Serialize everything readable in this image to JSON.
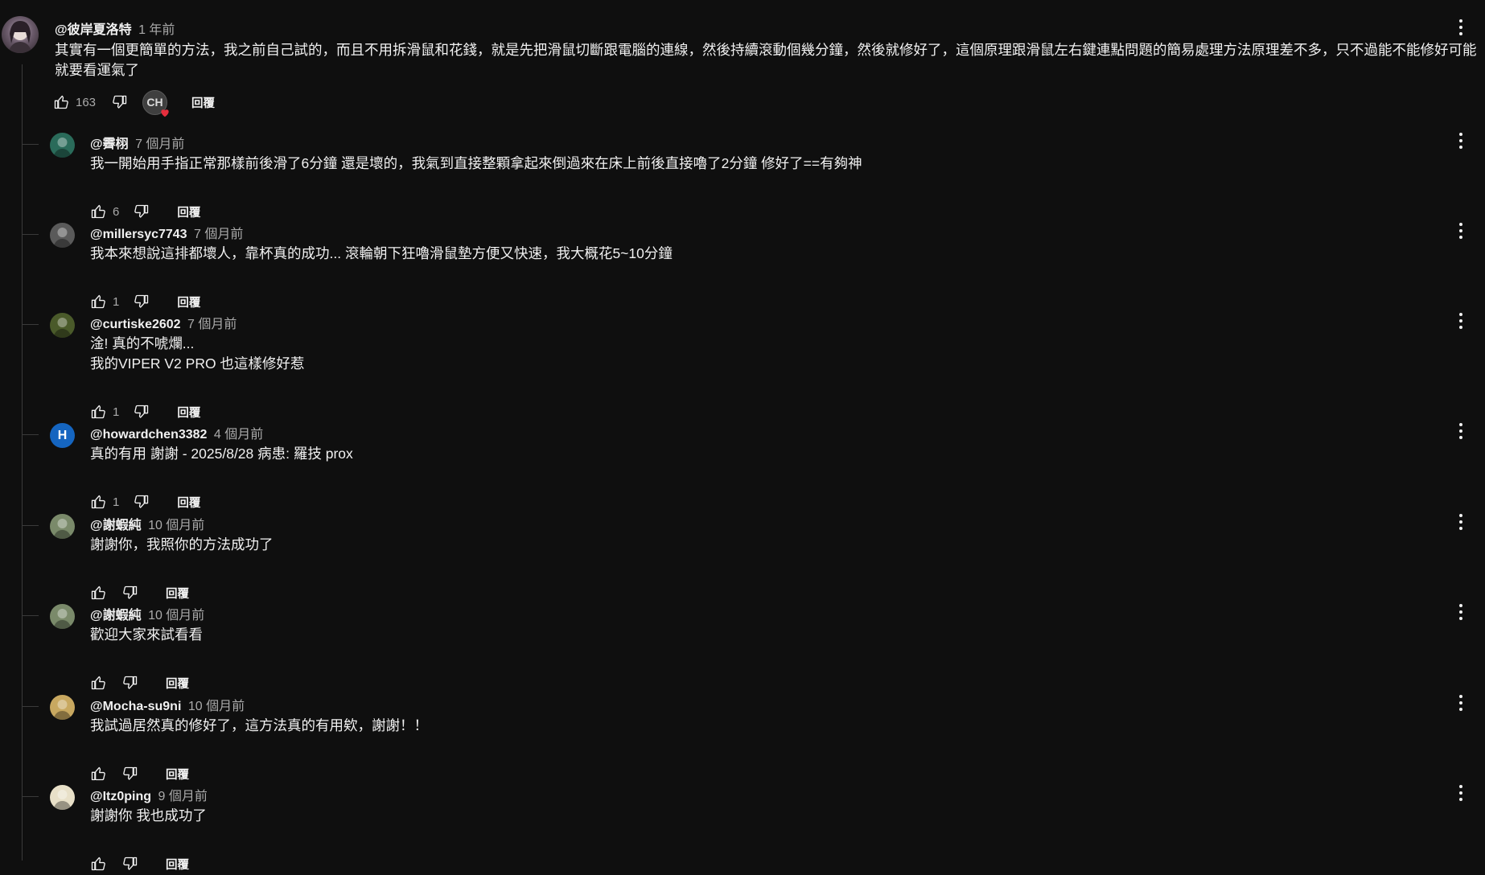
{
  "colors": {
    "background": "#0f0f0f",
    "text": "#f1f1f1",
    "muted": "#aaaaaa",
    "heart": "#e62e3d",
    "avatar_h": "#1565c0"
  },
  "top_comment": {
    "author": "@彼岸夏洛特",
    "time": "1 年前",
    "text_line1": "其實有一個更簡單的方法，我之前自己試的，而且不用拆滑鼠和花錢，就是先把滑鼠切斷跟電腦的連線，然後持續滾動個幾分鐘，然後就修好了，這個原理跟滑鼠左右鍵連點問題的簡易處理方法原理差不多，只不過能不能修好可能",
    "text_line2": "就要看運氣了",
    "likes": "163",
    "creator_heart_initials": "CH",
    "reply_label": "回覆",
    "icons": {
      "like": "thumb-up-icon",
      "dislike": "thumb-down-icon",
      "more": "more-vert-icon",
      "heart": "heart-icon"
    }
  },
  "replies": [
    {
      "author": "@霽栩",
      "time": "7 個月前",
      "lines": [
        "我一開始用手指正常那樣前後滑了6分鐘 還是壞的，我氣到直接整顆拿起來倒過來在床上前後直接嚕了2分鐘 修好了==有夠神"
      ],
      "likes": "6",
      "reply_label": "回覆",
      "avatar_color": "#2a6b5a"
    },
    {
      "author": "@millersyc7743",
      "time": "7 個月前",
      "lines": [
        "我本來想說這排都壞人，靠杯真的成功... 滾輪朝下狂嚕滑鼠墊方便又快速，我大概花5~10分鐘"
      ],
      "likes": "1",
      "reply_label": "回覆",
      "avatar_color": "#5a5a5a"
    },
    {
      "author": "@curtiske2602",
      "time": "7 個月前",
      "lines": [
        "淦! 真的不唬爛...",
        "我的VIPER V2 PRO 也這樣修好惹"
      ],
      "likes": "1",
      "reply_label": "回覆",
      "avatar_color": "#4a5a2a"
    },
    {
      "author": "@howardchen3382",
      "time": "4 個月前",
      "lines": [
        "真的有用 謝謝 - 2025/8/28 病患: 羅技 prox"
      ],
      "likes": "1",
      "reply_label": "回覆",
      "avatar_letter": "H",
      "avatar_color": "#1565c0"
    },
    {
      "author": "@謝蝦純",
      "time": "10 個月前",
      "lines": [
        "謝謝你，我照你的方法成功了"
      ],
      "likes": "",
      "reply_label": "回覆",
      "avatar_color": "#7a8a6a"
    },
    {
      "author": "@謝蝦純",
      "time": "10 個月前",
      "lines": [
        "歡迎大家來試看看"
      ],
      "likes": "",
      "reply_label": "回覆",
      "avatar_color": "#7a8a6a"
    },
    {
      "author": "@Mocha-su9ni",
      "time": "10 個月前",
      "lines": [
        "我試過居然真的修好了，這方法真的有用欸，謝謝！！"
      ],
      "likes": "",
      "reply_label": "回覆",
      "avatar_color": "#c8a860"
    },
    {
      "author": "@Itz0ping",
      "time": "9 個月前",
      "lines": [
        "謝謝你 我也成功了"
      ],
      "likes": "",
      "reply_label": "回覆",
      "avatar_color": "#e8e0c8"
    }
  ]
}
